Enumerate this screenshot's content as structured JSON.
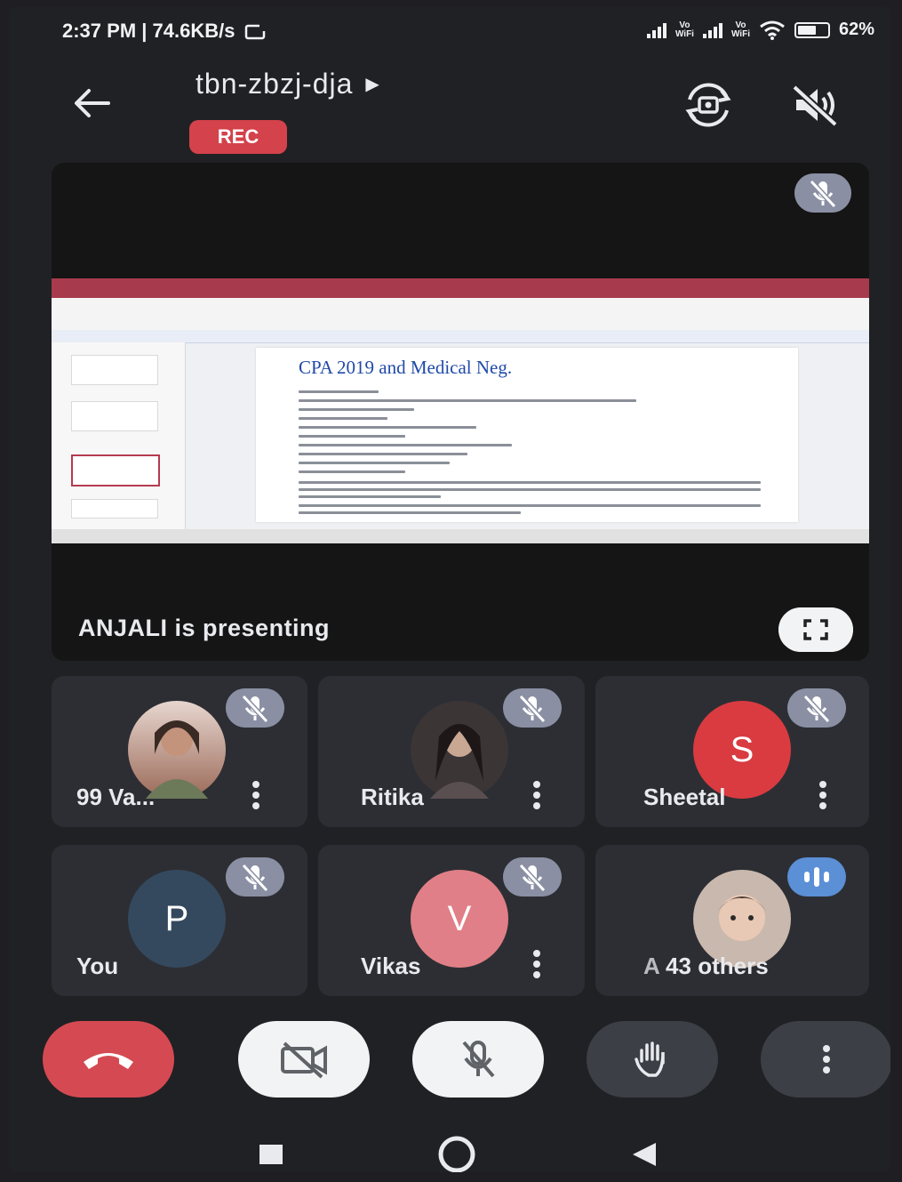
{
  "status_bar": {
    "time_speed": "2:37 PM | 74.6KB/s",
    "network_label_1": "Vo\nWiFi",
    "network_label_2": "Vo\nWiFi",
    "battery_percent": "62%",
    "battery_level": 0.62
  },
  "header": {
    "meeting_code": "tbn-zbzj-dja",
    "rec_badge": "REC"
  },
  "presentation": {
    "presenter_label": "ANJALI is presenting",
    "slide_title": "CPA 2019 and Medical Neg."
  },
  "participants": [
    {
      "name": "99 Va...",
      "avatar_type": "photo",
      "muted": true,
      "has_menu": true
    },
    {
      "name": "Ritika",
      "avatar_type": "photo",
      "muted": true,
      "has_menu": true
    },
    {
      "name": "Sheetal",
      "avatar_type": "letter",
      "avatar_letter": "S",
      "avatar_color": "#d93b41",
      "muted": true,
      "has_menu": true
    },
    {
      "name": "You",
      "avatar_type": "letter",
      "avatar_letter": "P",
      "avatar_color": "#34495e",
      "muted": true,
      "has_menu": false
    },
    {
      "name": "Vikas",
      "avatar_type": "letter",
      "avatar_letter": "V",
      "avatar_color": "#e07f87",
      "muted": true,
      "has_menu": true
    },
    {
      "name": "43 others",
      "name_prefix": "A",
      "avatar_type": "photo",
      "speaking": true,
      "has_menu": false
    }
  ],
  "controls": {
    "icons": [
      "end-call-icon",
      "camera-off-icon",
      "mic-off-icon",
      "raise-hand-icon",
      "more-options-icon"
    ],
    "colors": {
      "end_call": "#d54a52",
      "light_button": "#f1f3f4",
      "dark_button": "#3c3f46"
    }
  },
  "nav": {
    "icons": [
      "recents-square-icon",
      "home-circle-icon",
      "back-triangle-icon"
    ]
  }
}
